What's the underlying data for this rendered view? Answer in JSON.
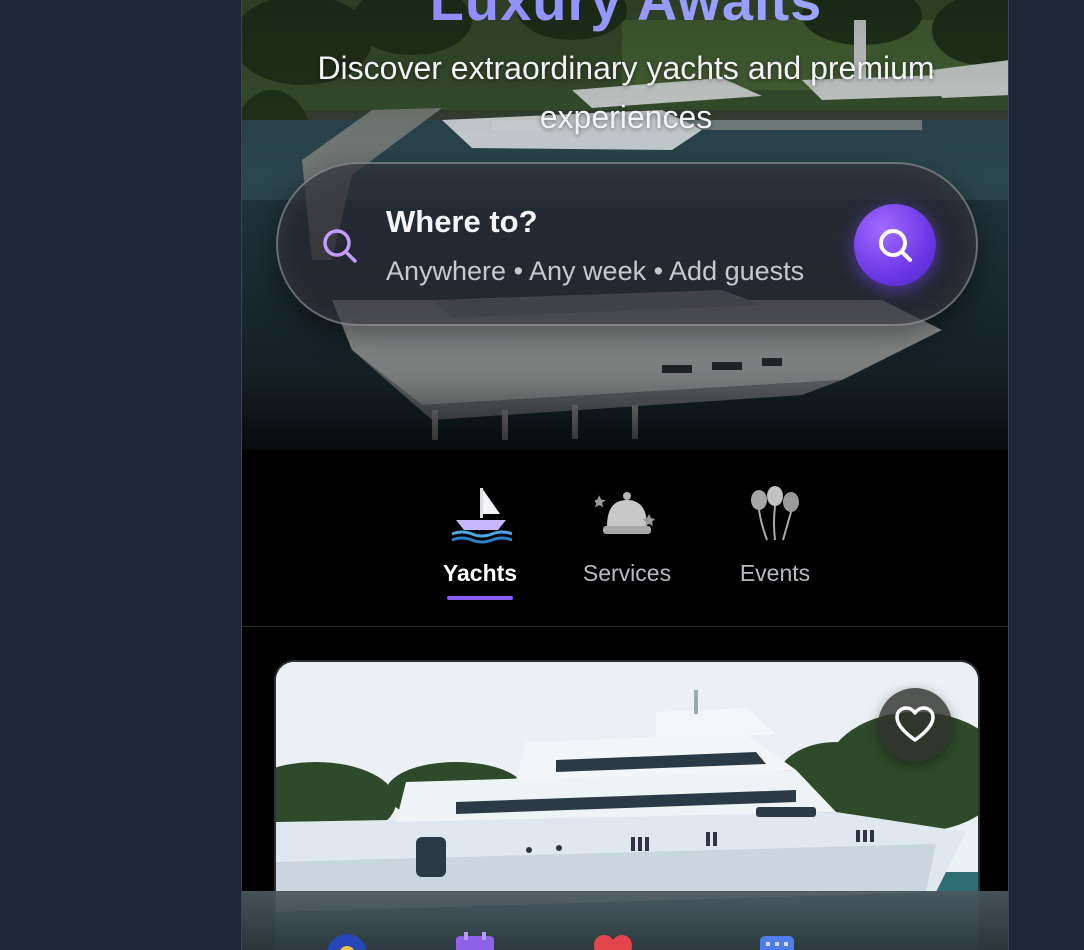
{
  "hero": {
    "title": "Luxury Awaits",
    "subtitle": "Discover extraordinary yachts and premium experiences"
  },
  "search": {
    "title": "Where to?",
    "details": "Anywhere • Any week • Add guests",
    "icon": "search-icon",
    "button_icon": "search-icon"
  },
  "categories": [
    {
      "label": "Yachts",
      "icon": "sailboat-icon",
      "active": true
    },
    {
      "label": "Services",
      "icon": "service-bell-icon",
      "active": false
    },
    {
      "label": "Events",
      "icon": "balloons-icon",
      "active": false
    }
  ],
  "listing": {
    "favorite_icon": "heart-icon"
  },
  "bottom_nav": [
    {
      "icon": "explore-icon"
    },
    {
      "icon": "calendar-icon"
    },
    {
      "icon": "heart-icon"
    },
    {
      "icon": "grid-icon"
    }
  ],
  "colors": {
    "accent": "#7c4dff",
    "background": "#1d2738",
    "tab_underline": "#8a5cf6"
  }
}
